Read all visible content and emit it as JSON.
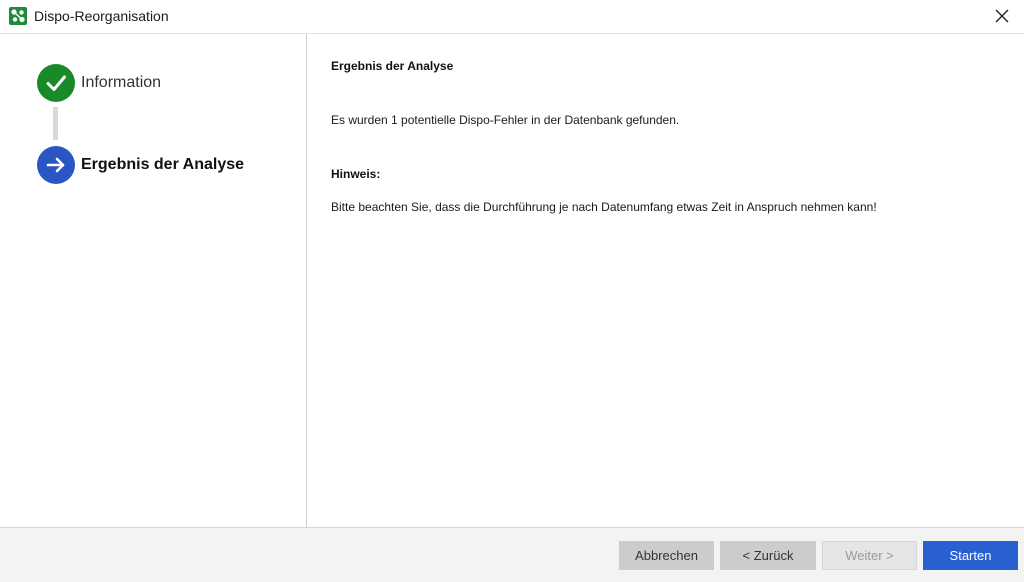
{
  "window": {
    "title": "Dispo-Reorganisation",
    "app_icon": "app-logo-icon",
    "close_icon": "close-icon"
  },
  "steps": [
    {
      "label": "Information",
      "state": "done",
      "icon": "checkmark-icon"
    },
    {
      "label": "Ergebnis der Analyse",
      "state": "current",
      "icon": "arrow-right-icon"
    }
  ],
  "main": {
    "section_title": "Ergebnis der Analyse",
    "message": "Es wurden 1 potentielle Dispo-Fehler in der Datenbank gefunden.",
    "hint_heading": "Hinweis:",
    "hint_text": "Bitte beachten Sie, dass die Durchführung je nach Datenumfang etwas Zeit in Anspruch nehmen kann!"
  },
  "footer": {
    "cancel_label": "Abbrechen",
    "back_label": "< Zurück",
    "next_label": "Weiter >",
    "start_label": "Starten"
  },
  "colors": {
    "step_done": "#1a8a28",
    "step_current": "#2a55c4",
    "primary_button": "#2a5fd1",
    "app_icon": "#1f8a3a"
  }
}
